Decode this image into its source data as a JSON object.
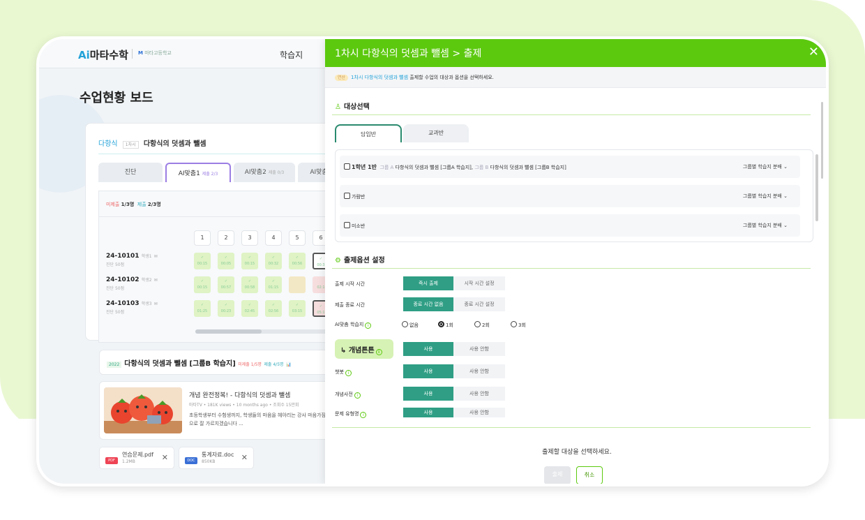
{
  "left": {
    "logo_ai": "Ai",
    "logo_text": "마타수학",
    "school": "마타고등학교",
    "nav_worksheet": "학습지",
    "page_title": "수업현황 보드",
    "crumb_subject": "다항식",
    "crumb_tag": "1차시",
    "crumb_title": "다항식의 덧셈과 뺄셈",
    "tabs": [
      {
        "label": "진단",
        "sub": ""
      },
      {
        "label": "AI맞춤1",
        "sub": "제출 2/3"
      },
      {
        "label": "AI맞춤2",
        "sub": "제출 0/3"
      },
      {
        "label": "AI맞춤",
        "sub": ""
      }
    ],
    "stat_unsub_label": "미제출",
    "stat_unsub": "1/3명",
    "stat_sub_label": "제출",
    "stat_sub": "2/3명",
    "columns": [
      "1",
      "2",
      "3",
      "4",
      "5",
      "6"
    ],
    "students": [
      {
        "id": "24-10101",
        "name": "학생1",
        "sub": "진단  50점",
        "cells": [
          "00:15",
          "00:05",
          "00:15",
          "00:32",
          "00:56",
          "00:3"
        ]
      },
      {
        "id": "24-10102",
        "name": "학생2",
        "sub": "진단  50점",
        "cells": [
          "00:15",
          "00:57",
          "00:58",
          "01:15",
          "",
          "02:1"
        ]
      },
      {
        "id": "24-10103",
        "name": "학생3",
        "sub": "진단  50점",
        "cells": [
          "01:25",
          "00:23",
          "02:45",
          "02:56",
          "03:15",
          "05:1"
        ]
      }
    ],
    "item2_year": "2022",
    "item2_title": "다항식의 덧셈과 뺄셈 [그룹B 학습지]",
    "item2_unsub": "미제출 1/5명",
    "item2_sub": "제출 4/5명",
    "video_title": "개념 완전정복! - 다항식의 덧셈과 뺄셈",
    "video_meta": "마타TV  •  181K views  •  10 months ago  •  조회수 15만회",
    "video_desc": "초등학생부터 수험생까지, 학생들의 마음을 헤아리는 강사 마음가짐으로 잘 가르치겠습니다 ...",
    "files": [
      {
        "name": "연습문제.pdf",
        "size": "1.2MB",
        "type": "PDF",
        "color": "#e45"
      },
      {
        "name": "통계자료.doc",
        "size": "850KB",
        "type": "DOC",
        "color": "#3a6fd6"
      }
    ]
  },
  "panel": {
    "title": "1차시 다항식의 덧셈과 뺄셈 > 출제",
    "notice_badge": "연산",
    "notice_hl": "1차시 다항식의 덧셈과 뺄셈",
    "notice_text": "출제할 수업의 대상과 옵션을 선택하세요.",
    "target_section": "대상선택",
    "target_tabs": [
      "담임반",
      "교과반"
    ],
    "classes": [
      {
        "name": "1학년 1반",
        "ga": "그룹 A",
        "gatext": "다항식의 덧셈과 뺄셈 [그룹A 학습지],",
        "gb": "그룹 B",
        "gbtext": "다항식의 덧셈과 뺄셈 [그룹B 학습지]",
        "dd": "그룹별 학습지 분배"
      },
      {
        "name": "가람반",
        "dd": "그룹별 학습지 분배"
      },
      {
        "name": "미소반",
        "dd": "그룹별 학습지 분배"
      }
    ],
    "option_section": "출제옵션 설정",
    "start_label": "출제 시작 시간",
    "start_on": "즉시 출제",
    "start_off": "시작 시간 설정",
    "end_label": "제출 종료 시간",
    "end_on": "종료 시간 없음",
    "end_off": "종료 시간 설정",
    "ai_label": "AI맞춤 학습지",
    "ai_opts": [
      "없음",
      "1회",
      "2회",
      "3회"
    ],
    "concept_label": "↳ 개념튼튼",
    "use": "사용",
    "nouse": "사용 안함",
    "chatbot_label": "챗봇",
    "dict_label": "개념사전",
    "type_label": "문제 유형명",
    "footer_msg": "출제할 대상을 선택하세요.",
    "submit": "출제",
    "cancel": "취소"
  },
  "colors": {
    "brand": "#5cc90f",
    "teal": "#2f9e84",
    "accent": "#22a2d8"
  }
}
